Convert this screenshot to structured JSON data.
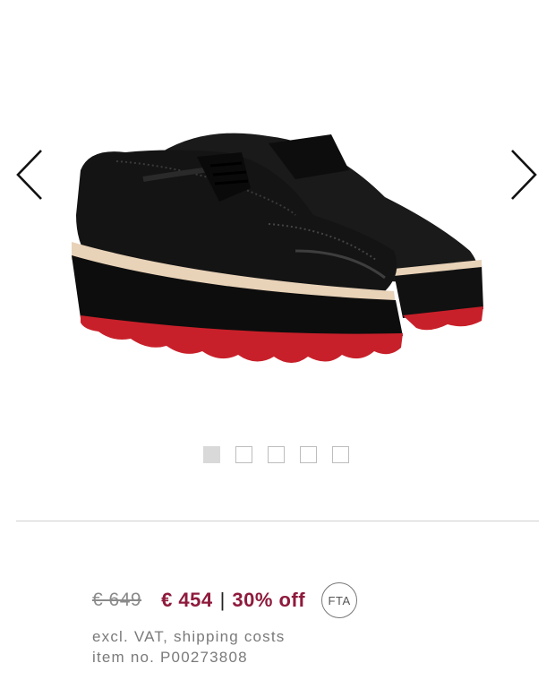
{
  "product": {
    "image_icon": "black-patent-brogue-platform-shoe-red-sole"
  },
  "gallery": {
    "prev_icon": "chevron-left-icon",
    "next_icon": "chevron-right-icon",
    "image_count": 5,
    "active_index": 0
  },
  "pricing": {
    "old_price": "€ 649",
    "new_price": "€ 454",
    "separator": "|",
    "discount": "30% off",
    "badge": "FTA",
    "vat_note": "excl. VAT, shipping costs",
    "item_no": "item no. P00273808"
  },
  "colors": {
    "accent": "#8e1a3c",
    "muted": "#7a7a7a",
    "sole_red": "#c8202a"
  }
}
